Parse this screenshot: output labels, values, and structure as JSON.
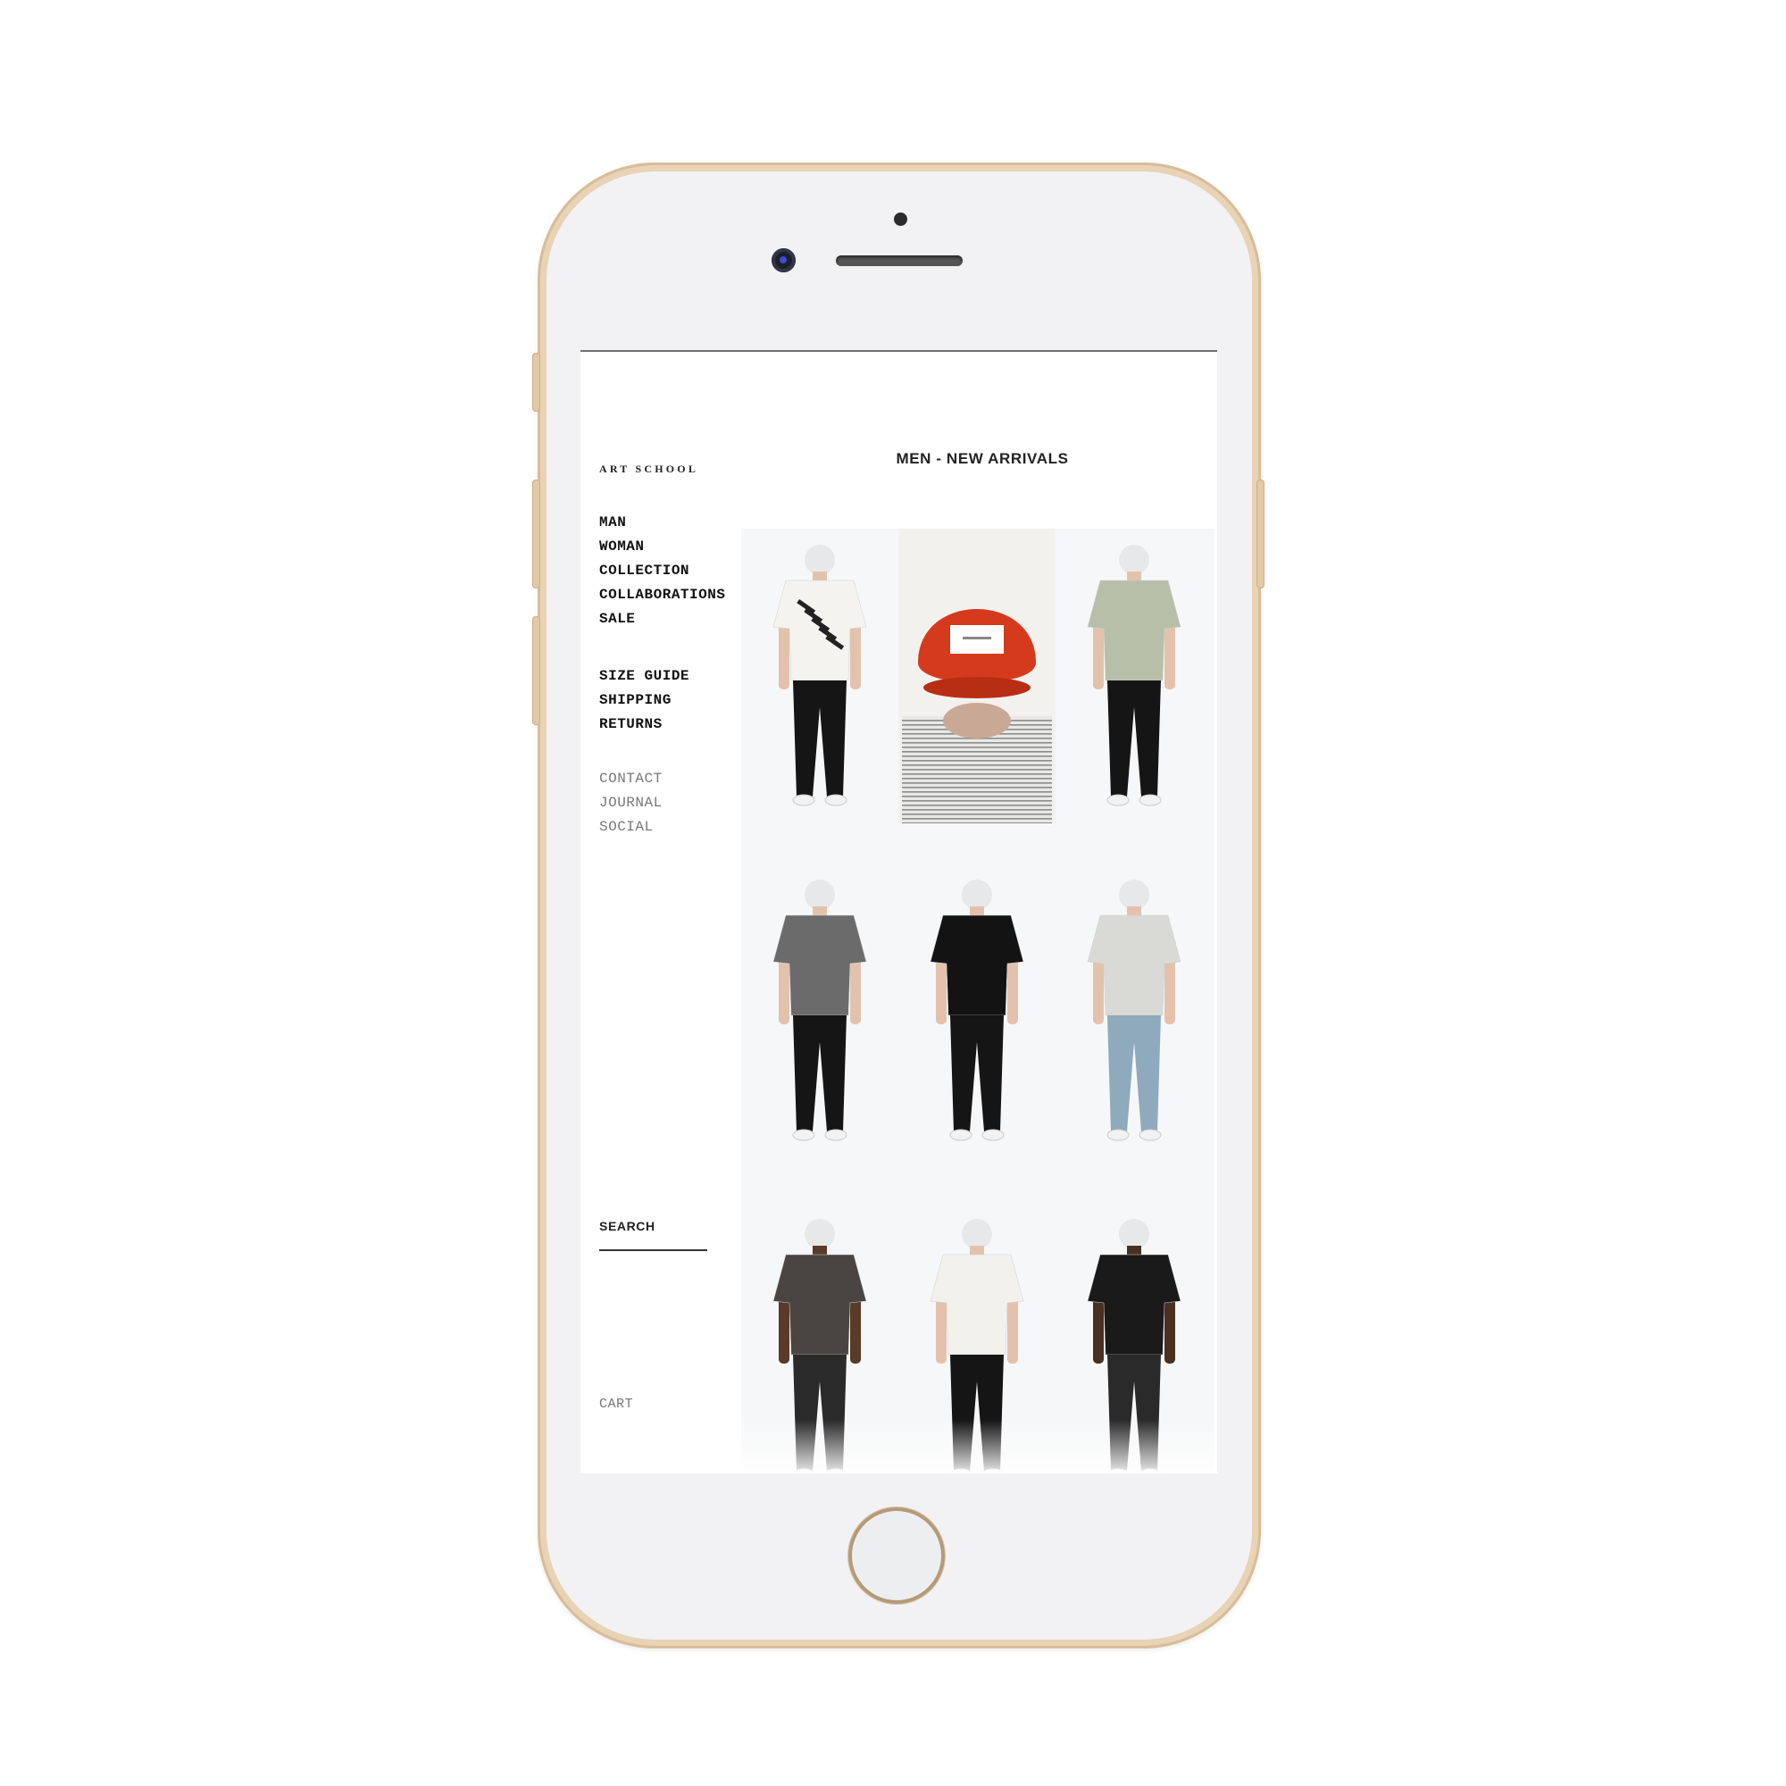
{
  "site": {
    "logo": "ART SCHOOL",
    "page_title": "MEN - NEW ARRIVALS"
  },
  "nav": {
    "primary": [
      "MAN",
      "WOMAN",
      "COLLECTION",
      "COLLABORATIONS",
      "SALE"
    ],
    "info": [
      "SIZE GUIDE",
      "SHIPPING",
      "RETURNS"
    ],
    "secondary": [
      "CONTACT",
      "JOURNAL",
      "SOCIAL"
    ]
  },
  "search": {
    "label": "SEARCH"
  },
  "cart": {
    "label": "CART"
  },
  "products": [
    {
      "kind": "model",
      "top": "#f4f3ef",
      "bottom": "#151515",
      "print": "graphic"
    },
    {
      "kind": "cap",
      "cap": "#d63a1c",
      "shirt": "stripe"
    },
    {
      "kind": "model",
      "top": "#b7bfa9",
      "bottom": "#151515"
    },
    {
      "kind": "model",
      "top": "#6b6b6b",
      "bottom": "#151515"
    },
    {
      "kind": "model",
      "top": "#131313",
      "bottom": "#151515"
    },
    {
      "kind": "model",
      "top": "#d9d9d6",
      "bottom": "#8fa9bd"
    },
    {
      "kind": "model",
      "top": "#4a4542",
      "bottom": "#2a2a2a",
      "skin": "#5a3a28"
    },
    {
      "kind": "model",
      "top": "#f2f1ec",
      "bottom": "#151515"
    },
    {
      "kind": "model",
      "top": "#1a1a1a",
      "bottom": "#2a2a2a",
      "skin": "#4a3020"
    }
  ],
  "colors": {
    "phone_frame": "#e8d3b7",
    "grid_background": "#f6f7f9",
    "text_primary": "#111111",
    "text_muted": "#777777"
  }
}
